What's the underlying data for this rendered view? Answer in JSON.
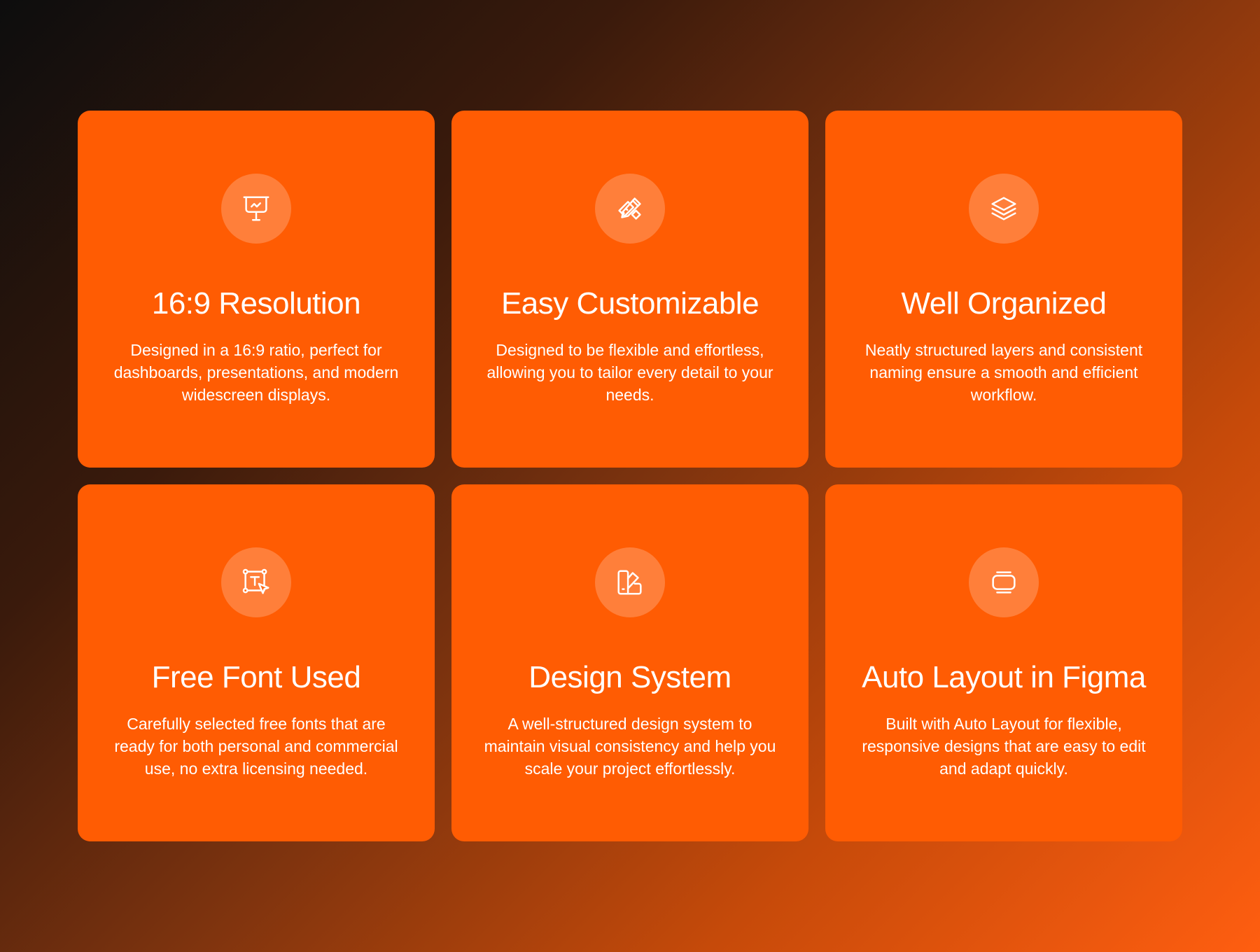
{
  "colors": {
    "card_background": "#ff5c03",
    "text": "#ffffff",
    "icon_circle": "rgba(255,255,255,0.22)"
  },
  "features": [
    {
      "icon": "presentation-board-icon",
      "title": "16:9 Resolution",
      "description": "Designed in a 16:9 ratio, perfect for dashboards, presentations, and modern widescreen displays."
    },
    {
      "icon": "pencil-ruler-icon",
      "title": "Easy Customizable",
      "description": "Designed to be flexible and effortless, allowing you to tailor every detail to your needs."
    },
    {
      "icon": "layers-icon",
      "title": "Well Organized",
      "description": "Neatly structured layers and consistent naming ensure a smooth and efficient workflow."
    },
    {
      "icon": "text-selection-cursor-icon",
      "title": "Free Font Used",
      "description": "Carefully selected free fonts that are ready for both personal and commercial use, no extra licensing needed."
    },
    {
      "icon": "design-system-icon",
      "title": "Design System",
      "description": "A well-structured design system to maintain visual consistency and help you scale your project effortlessly."
    },
    {
      "icon": "auto-layout-icon",
      "title": "Auto Layout in Figma",
      "description": "Built with Auto Layout for flexible, responsive designs that are easy to edit and adapt quickly."
    }
  ]
}
